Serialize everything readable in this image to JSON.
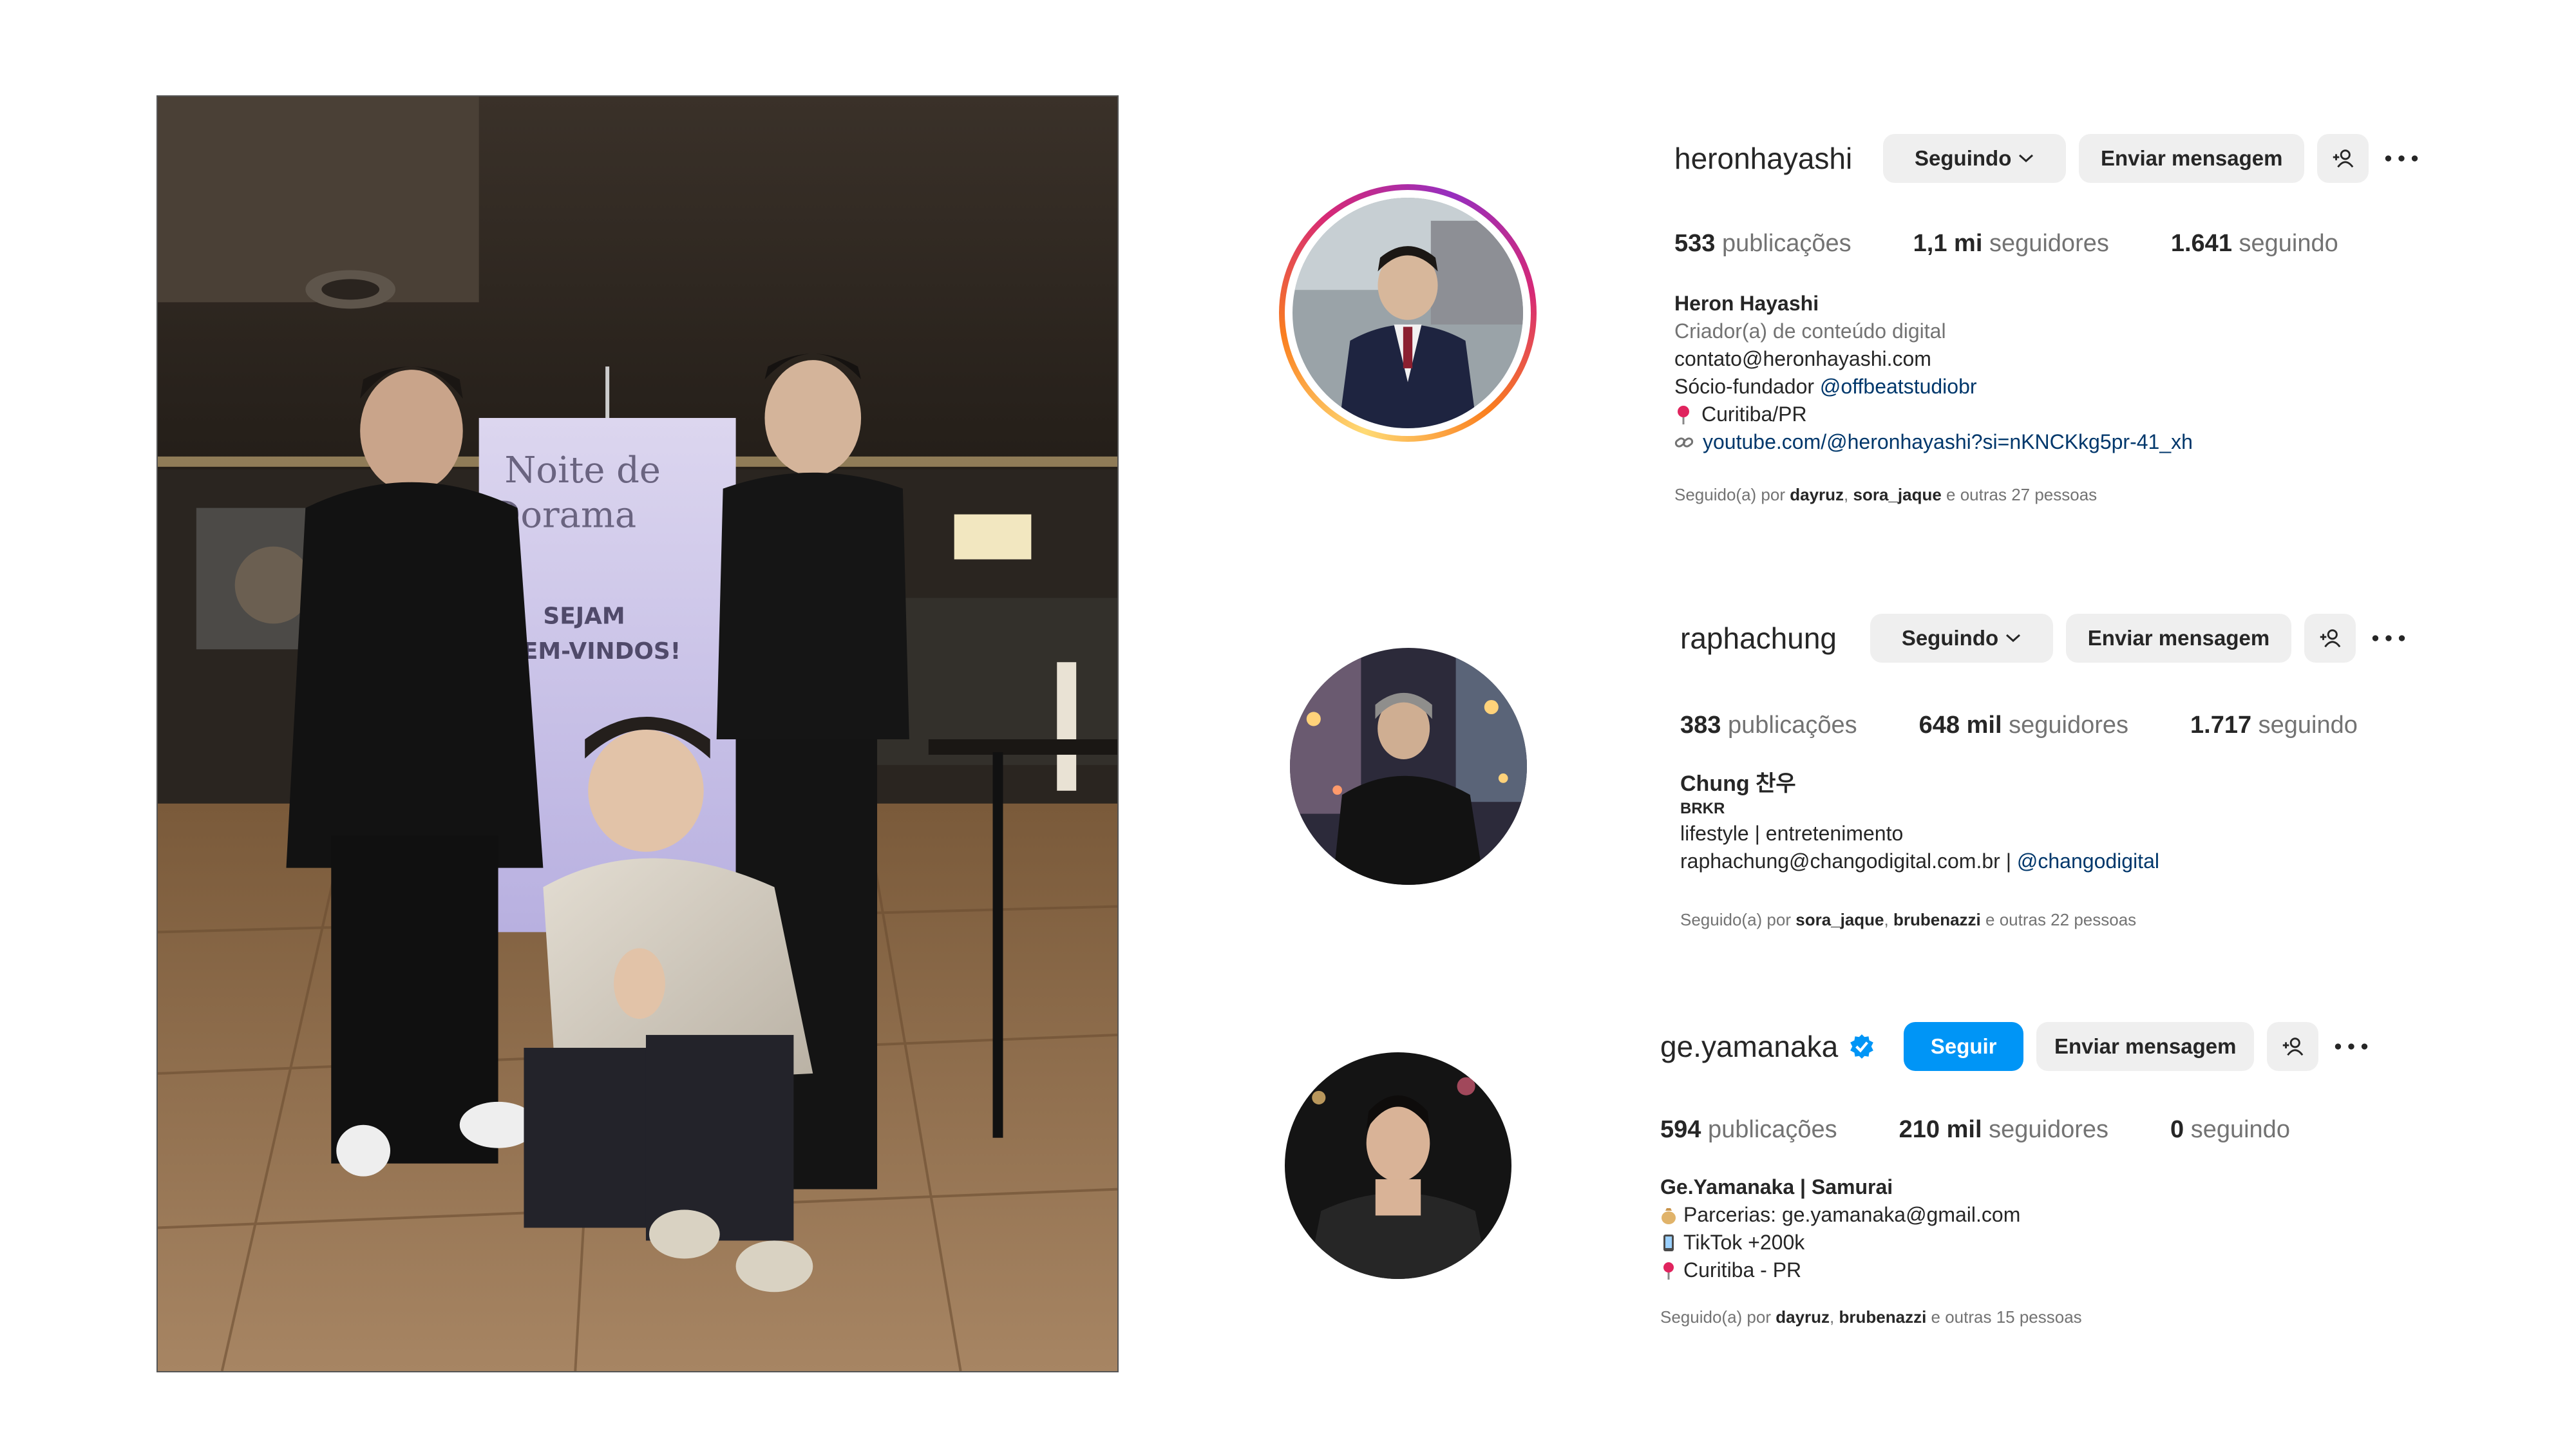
{
  "profiles": [
    {
      "username": "heronhayashi",
      "follow_label": "Seguindo",
      "message_label": "Enviar mensagem",
      "stats": [
        {
          "value": "533",
          "label": "publicações"
        },
        {
          "value": "1,1 mi",
          "label": "seguidores"
        },
        {
          "value": "1.641",
          "label": "seguindo"
        }
      ],
      "full_name": "Heron Hayashi",
      "category": "Criador(a) de conteúdo digital",
      "bio": {
        "email": "contato@heronhayashi.com",
        "partner_prefix": "Sócio-fundador ",
        "partner_tag": "@offbeatstudiobr",
        "location": "Curitiba/PR",
        "link": "youtube.com/@heronhayashi?si=nKNCKkg5pr-41_xh"
      },
      "followed_by": {
        "prefix": "Seguido(a) por ",
        "user1": "dayruz",
        "sep": ", ",
        "user2": "sora_jaque",
        "suffix": " e outras 27 pessoas"
      }
    },
    {
      "username": "raphachung",
      "follow_label": "Seguindo",
      "message_label": "Enviar mensagem",
      "stats": [
        {
          "value": "383",
          "label": "publicações"
        },
        {
          "value": "648 mil",
          "label": "seguidores"
        },
        {
          "value": "1.717",
          "label": "seguindo"
        }
      ],
      "full_name": "Chung 찬우",
      "bio": {
        "small": "BRKR",
        "line1": "lifestyle | entretenimento",
        "email": "raphachung@changodigital.com.br | ",
        "tag": "@changodigital"
      },
      "followed_by": {
        "prefix": "Seguido(a) por ",
        "user1": "sora_jaque",
        "sep": ", ",
        "user2": "brubenazzi",
        "suffix": " e outras 22 pessoas"
      }
    },
    {
      "username": "ge.yamanaka",
      "follow_label": "Seguir",
      "message_label": "Enviar mensagem",
      "stats": [
        {
          "value": "594",
          "label": "publicações"
        },
        {
          "value": "210 mil",
          "label": "seguidores"
        },
        {
          "value": "0",
          "label": "seguindo"
        }
      ],
      "full_name": "Ge.Yamanaka | Samurai",
      "bio": {
        "line1": "Parcerias: ge.yamanaka@gmail.com",
        "line2": "TikTok +200k",
        "location": "Curitiba - PR"
      },
      "followed_by": {
        "prefix": "Seguido(a) por ",
        "user1": "dayruz",
        "sep": ", ",
        "user2": "brubenazzi",
        "suffix": " e outras 15 pessoas"
      }
    }
  ],
  "photo": {
    "banner_title": "Noite de Dorama",
    "banner_subtitle": "Sejam bem-vindos!"
  },
  "colors": {
    "accent_blue": "#0095f6",
    "link": "#00376b",
    "muted": "#737373",
    "button_gray": "#efefef"
  }
}
